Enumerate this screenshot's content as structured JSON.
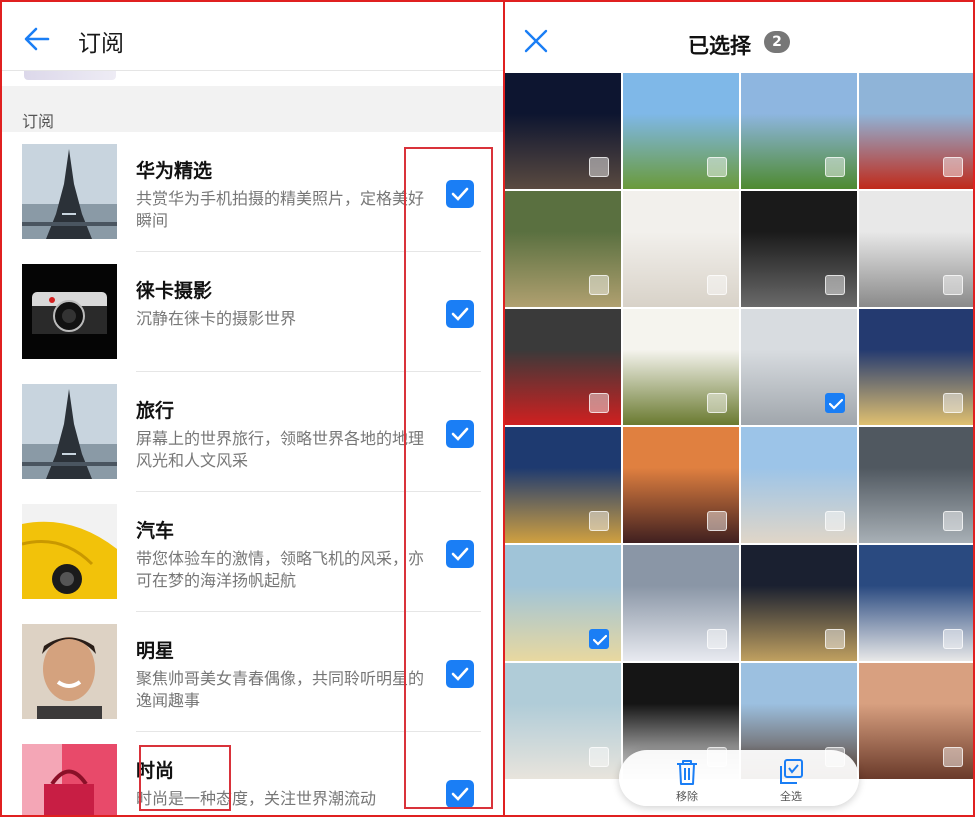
{
  "left": {
    "header": {
      "title": "订阅",
      "back_icon": "arrow-left-icon"
    },
    "section_label": "订阅",
    "items": [
      {
        "title": "华为精选",
        "desc": "共赏华为手机拍摄的精美照片，定格美好瞬间",
        "checked": true,
        "thumb": "eiffel-tower"
      },
      {
        "title": "徕卡摄影",
        "desc": "沉静在徕卡的摄影世界",
        "checked": true,
        "thumb": "leica-camera"
      },
      {
        "title": "旅行",
        "desc": "屏幕上的世界旅行，领略世界各地的地理风光和人文风采",
        "checked": true,
        "thumb": "eiffel-tower"
      },
      {
        "title": "汽车",
        "desc": "带您体验车的激情，领略飞机的风采，亦可在梦的海洋扬帆起航",
        "checked": true,
        "thumb": "yellow-car"
      },
      {
        "title": "明星",
        "desc": "聚焦帅哥美女青春偶像，共同聆听明星的逸闻趣事",
        "checked": true,
        "thumb": "smiling-man"
      },
      {
        "title": "时尚",
        "desc": "时尚是一种态度，关注世界潮流动",
        "checked": true,
        "thumb": "red-handbag"
      }
    ]
  },
  "right": {
    "header": {
      "title": "已选择",
      "count": "2",
      "close_icon": "close-icon"
    },
    "photos": [
      {
        "scene": "night-city",
        "selected": false
      },
      {
        "scene": "river-grassland",
        "selected": false
      },
      {
        "scene": "mountain-valley",
        "selected": false
      },
      {
        "scene": "red-beach",
        "selected": false
      },
      {
        "scene": "wetland-aerial",
        "selected": false
      },
      {
        "scene": "white-interior",
        "selected": false
      },
      {
        "scene": "watch",
        "selected": false
      },
      {
        "scene": "man-grey-shirt",
        "selected": false
      },
      {
        "scene": "red-dress",
        "selected": false
      },
      {
        "scene": "green-tea",
        "selected": false
      },
      {
        "scene": "silver-car",
        "selected": true
      },
      {
        "scene": "snow-village",
        "selected": false
      },
      {
        "scene": "observatory",
        "selected": false
      },
      {
        "scene": "sunset-lake",
        "selected": false
      },
      {
        "scene": "coastal-town",
        "selected": false
      },
      {
        "scene": "city-mirror",
        "selected": false
      },
      {
        "scene": "aerial-river",
        "selected": true
      },
      {
        "scene": "desert-tree",
        "selected": false
      },
      {
        "scene": "tennis-trophy",
        "selected": false
      },
      {
        "scene": "footballer",
        "selected": false
      },
      {
        "scene": "jewelry",
        "selected": false
      },
      {
        "scene": "fashion-white",
        "selected": false
      },
      {
        "scene": "pagoda",
        "selected": false
      },
      {
        "scene": "pier",
        "selected": false
      }
    ],
    "toolbar": {
      "remove_label": "移除",
      "remove_icon": "trash-icon",
      "select_all_label": "全选",
      "select_all_icon": "select-all-icon"
    }
  },
  "colors": {
    "accent": "#1a7ef5",
    "highlight": "#d9323a"
  }
}
